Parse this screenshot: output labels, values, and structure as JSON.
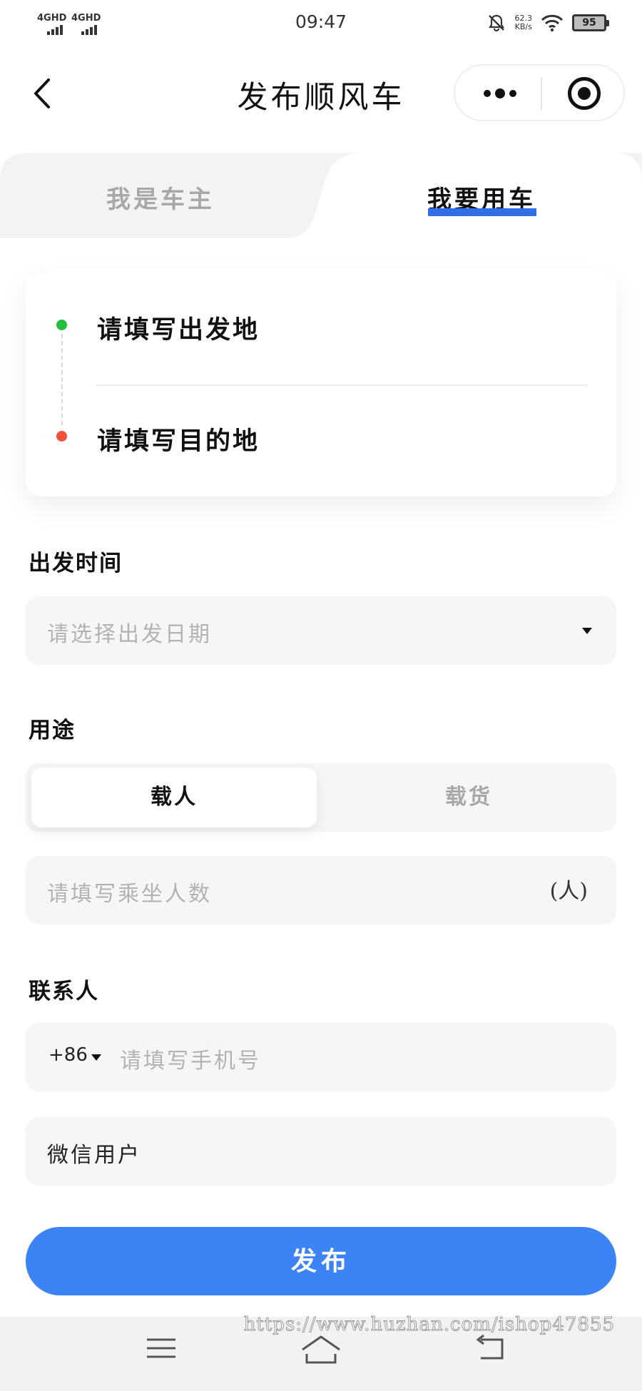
{
  "status_bar": {
    "signal_1": "4GHD",
    "signal_2": "4GHD",
    "time": "09:47",
    "net_speed_value": "62.3",
    "net_speed_unit": "KB/s",
    "battery": "95",
    "icons": [
      "bell-off-icon",
      "wifi-icon",
      "battery-icon"
    ]
  },
  "nav": {
    "title": "发布顺风车",
    "back_icon": "chevron-left-icon",
    "more_icon": "more-dots-icon",
    "close_icon": "target-circle-icon"
  },
  "tabs": {
    "items": [
      {
        "label": "我是车主",
        "active": false
      },
      {
        "label": "我要用车",
        "active": true
      }
    ],
    "accent": "#2f6fe8"
  },
  "route": {
    "origin_placeholder": "请填写出发地",
    "destination_placeholder": "请填写目的地",
    "origin_color": "#22c03b",
    "destination_color": "#f0533b"
  },
  "departure": {
    "label": "出发时间",
    "placeholder": "请选择出发日期"
  },
  "purpose": {
    "label": "用途",
    "options": [
      {
        "label": "载人",
        "selected": true
      },
      {
        "label": "载货",
        "selected": false
      }
    ],
    "passengers_placeholder": "请填写乘坐人数",
    "passengers_unit": "(人)"
  },
  "contact": {
    "label": "联系人",
    "country_code": "+86",
    "phone_placeholder": "请填写手机号",
    "name_value": "微信用户"
  },
  "submit": {
    "label": "发布",
    "color": "#3c84f6"
  },
  "watermark": "https://www.huzhan.com/ishop47855",
  "system_nav": {
    "icons": [
      "menu-icon",
      "home-icon",
      "back-icon"
    ]
  }
}
